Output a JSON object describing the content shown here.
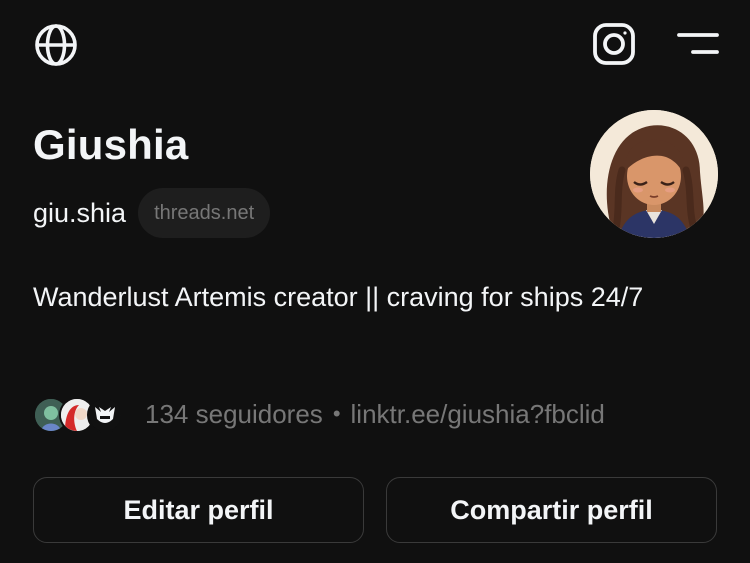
{
  "header": {
    "left_icon": "globe-icon",
    "right_icons": [
      "instagram-icon",
      "menu-icon"
    ]
  },
  "profile": {
    "display_name": "Giushia",
    "username": "giu.shia",
    "domain_badge": "threads.net",
    "bio": "Wanderlust Artemis creator || craving for ships 24/7",
    "followers_text": "134 seguidores",
    "separator": "•",
    "link": "linktr.ee/giushia?fbclid"
  },
  "actions": {
    "edit_label": "Editar perfil",
    "share_label": "Compartir perfil"
  },
  "colors": {
    "background": "#101010",
    "primary_text": "#f3f5f7",
    "secondary_text": "#777777",
    "badge_bg": "#1e1e1e",
    "button_border": "#3a3a3a"
  }
}
